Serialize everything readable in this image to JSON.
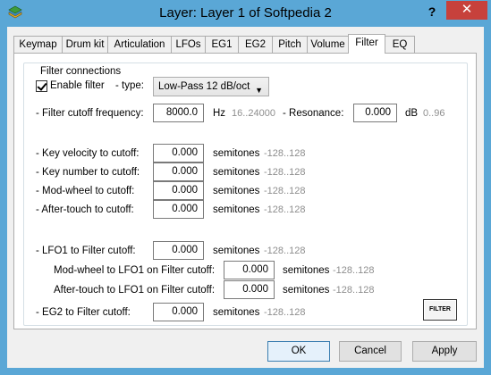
{
  "window": {
    "title": "Layer: Layer 1 of Softpedia 2",
    "help": "?",
    "close": "✕"
  },
  "tabs": [
    "Keymap",
    "Drum kit",
    "Articulation",
    "LFOs",
    "EG1",
    "EG2",
    "Pitch",
    "Volume",
    "Filter",
    "EQ"
  ],
  "active_tab": "Filter",
  "group_title": "Filter connections",
  "enable_filter": {
    "label": "Enable filter",
    "checked": true,
    "type_label": "-  type:",
    "type_value": "Low-Pass 12 dB/oct"
  },
  "cutoff": {
    "label": "-  Filter cutoff frequency:",
    "value": "8000.0",
    "unit": "Hz",
    "range": "16..24000"
  },
  "resonance": {
    "label": "-  Resonance:",
    "value": "0.000",
    "unit": "dB",
    "range": "0..96"
  },
  "rows": [
    {
      "label": "-  Key velocity to cutoff:",
      "value": "0.000",
      "unit": "semitones",
      "range": "-128..128"
    },
    {
      "label": "-  Key number to cutoff:",
      "value": "0.000",
      "unit": "semitones",
      "range": "-128..128"
    },
    {
      "label": "-  Mod-wheel to cutoff:",
      "value": "0.000",
      "unit": "semitones",
      "range": "-128..128"
    },
    {
      "label": "-  After-touch to cutoff:",
      "value": "0.000",
      "unit": "semitones",
      "range": "-128..128"
    },
    {
      "label": "-  LFO1 to Filter cutoff:",
      "value": "0.000",
      "unit": "semitones",
      "range": "-128..128"
    },
    {
      "label": "Mod-wheel to LFO1 on Filter cutoff:",
      "value": "0.000",
      "unit": "semitones",
      "range": "-128..128"
    },
    {
      "label": "After-touch to LFO1 on Filter cutoff:",
      "value": "0.000",
      "unit": "semitones",
      "range": "-128..128"
    },
    {
      "label": "-  EG2 to Filter cutoff:",
      "value": "0.000",
      "unit": "semitones",
      "range": "-128..128"
    }
  ],
  "filter_button": "FILTER",
  "buttons": {
    "ok": "OK",
    "cancel": "Cancel",
    "apply": "Apply"
  },
  "colors": {
    "title_bar": "#5aa7d6",
    "close": "#c7413c",
    "hint": "#8e8e8e"
  }
}
